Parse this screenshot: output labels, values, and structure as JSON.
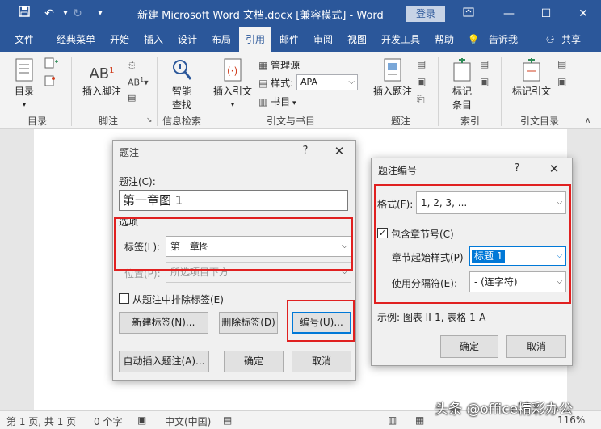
{
  "titlebar": {
    "title": "新建 Microsoft Word 文档.docx [兼容模式] - Word",
    "login": "登录"
  },
  "tabs": [
    "文件",
    "经典菜单",
    "开始",
    "插入",
    "设计",
    "布局",
    "引用",
    "邮件",
    "审阅",
    "视图",
    "开发工具",
    "帮助",
    "告诉我",
    "共享"
  ],
  "ribbon": {
    "toc": "目录",
    "insert_footnote": "插入脚注",
    "smart_lookup_l1": "智能",
    "smart_lookup_l2": "查找",
    "insert_citation": "插入引文",
    "manage_sources": "管理源",
    "style_label": "样式:",
    "style_value": "APA",
    "bibliography": "书目",
    "insert_caption": "插入题注",
    "mark_entry_l1": "标记",
    "mark_entry_l2": "条目",
    "mark_citation": "标记引文",
    "groups": [
      "目录",
      "脚注",
      "信息检索",
      "引文与书目",
      "题注",
      "索引",
      "引文目录"
    ]
  },
  "caption_dialog": {
    "title": "题注",
    "help": "?",
    "caption_label": "题注(C):",
    "caption_value": "第一章图 1",
    "options": "选项",
    "label_label": "标签(L):",
    "label_value": "第一章图",
    "position_label": "位置(P):",
    "position_value": "所选项目下方",
    "exclude_label": "从题注中排除标签(E)",
    "new_label": "新建标签(N)...",
    "delete_label": "删除标签(D)",
    "numbering": "编号(U)...",
    "autocaption": "自动插入题注(A)...",
    "ok": "确定",
    "cancel": "取消"
  },
  "numbering_dialog": {
    "title": "题注编号",
    "help": "?",
    "format_label": "格式(F):",
    "format_value": "1, 2, 3, ...",
    "include_chapter": "包含章节号(C)",
    "chapter_style_label": "章节起始样式(P)",
    "chapter_style_value": "标题 1",
    "separator_label": "使用分隔符(E):",
    "separator_value": "-    (连字符)",
    "example": "示例: 图表 II-1, 表格 1-A",
    "ok": "确定",
    "cancel": "取消"
  },
  "statusbar": {
    "page": "第 1 页, 共 1 页",
    "words": "0 个字",
    "lang": "中文(中国)",
    "zoom": "116%"
  },
  "watermark": "头条 @office精彩办公",
  "colors": {
    "brand": "#2b579a",
    "highlight": "#e02020",
    "focus": "#0078d7"
  }
}
